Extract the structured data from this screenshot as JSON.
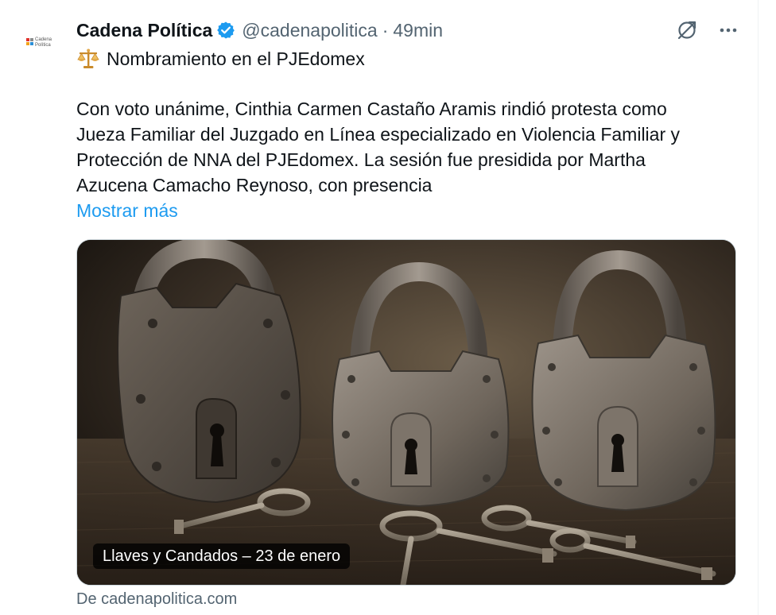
{
  "account": {
    "display_name": "Cadena Política",
    "handle": "@cadenapolitica",
    "separator": "·",
    "timestamp": "49min",
    "avatar_icon": "cadena-politica-logo",
    "verified_icon": "verified-badge-icon",
    "avatar_text_line1": "Cadena",
    "avatar_text_line2": "Política"
  },
  "header_actions": [
    {
      "icon": "grok-icon"
    },
    {
      "icon": "more-options-icon",
      "label": "···"
    }
  ],
  "tweet": {
    "title_emoji_icon": "balance-scale-icon",
    "title": "Nombramiento en el PJEdomex",
    "body_lines": [
      "Con voto unánime, Cinthia Carmen Castaño Aramis rindió protesta como",
      "Jueza Familiar del Juzgado en Línea especializado en Violencia Familiar y",
      "Protección de NNA del PJEdomex. La sesión fue presidida por Martha",
      "Azucena Camacho Reynoso, con presencia"
    ],
    "show_more": "Mostrar más"
  },
  "card": {
    "image_subject": "three antique padlocks with old keys",
    "caption": "Llaves y Candados – 23 de enero",
    "source": "De cadenapolitica.com"
  },
  "colors": {
    "text_primary": "#0f1419",
    "text_secondary": "#536471",
    "link_blue": "#1d9bf0",
    "verified_blue": "#1d9bf0",
    "border": "#cfd9de"
  }
}
